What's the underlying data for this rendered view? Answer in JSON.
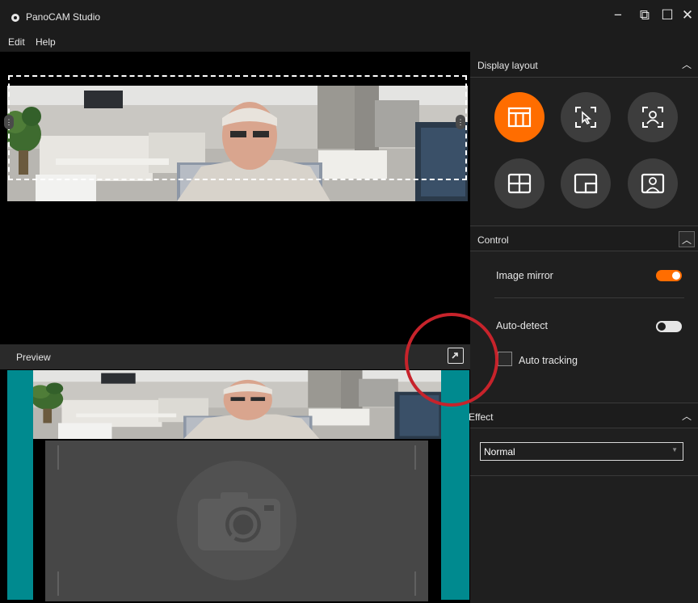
{
  "app": {
    "title": "PanoCAM Studio",
    "window_controls": {
      "minimize": "−",
      "restore": "⧉",
      "maximize": "☐",
      "close": "✕"
    }
  },
  "menu": {
    "items": [
      "Edit",
      "Help"
    ]
  },
  "preview": {
    "label": "Preview"
  },
  "right_panel": {
    "display_layout": {
      "title": "Display layout",
      "buttons": [
        {
          "name": "panorama-layout",
          "icon": "panorama-layout-icon",
          "active": true
        },
        {
          "name": "manual-select-layout",
          "icon": "cursor-frame-icon",
          "active": false
        },
        {
          "name": "person-focus-layout",
          "icon": "person-frame-icon",
          "active": false
        },
        {
          "name": "quad-split-layout",
          "icon": "grid-quad-icon",
          "active": false
        },
        {
          "name": "picture-in-picture-layout",
          "icon": "picture-in-picture-icon",
          "active": false
        },
        {
          "name": "speaker-layout",
          "icon": "speaker-portrait-icon",
          "active": false
        }
      ]
    },
    "control": {
      "title": "Control",
      "image_mirror": {
        "label": "Image mirror",
        "on": true
      },
      "auto_detect": {
        "label": "Auto-detect",
        "on": false
      },
      "auto_tracking": {
        "label": "Auto tracking",
        "checked": false
      }
    },
    "effect": {
      "title": "Effect",
      "selected": "Normal"
    }
  },
  "colors": {
    "accent": "#ff6d00",
    "teal": "#008a8f",
    "highlight_circle": "#c7232b",
    "panel_bg": "#1f1f1f"
  }
}
